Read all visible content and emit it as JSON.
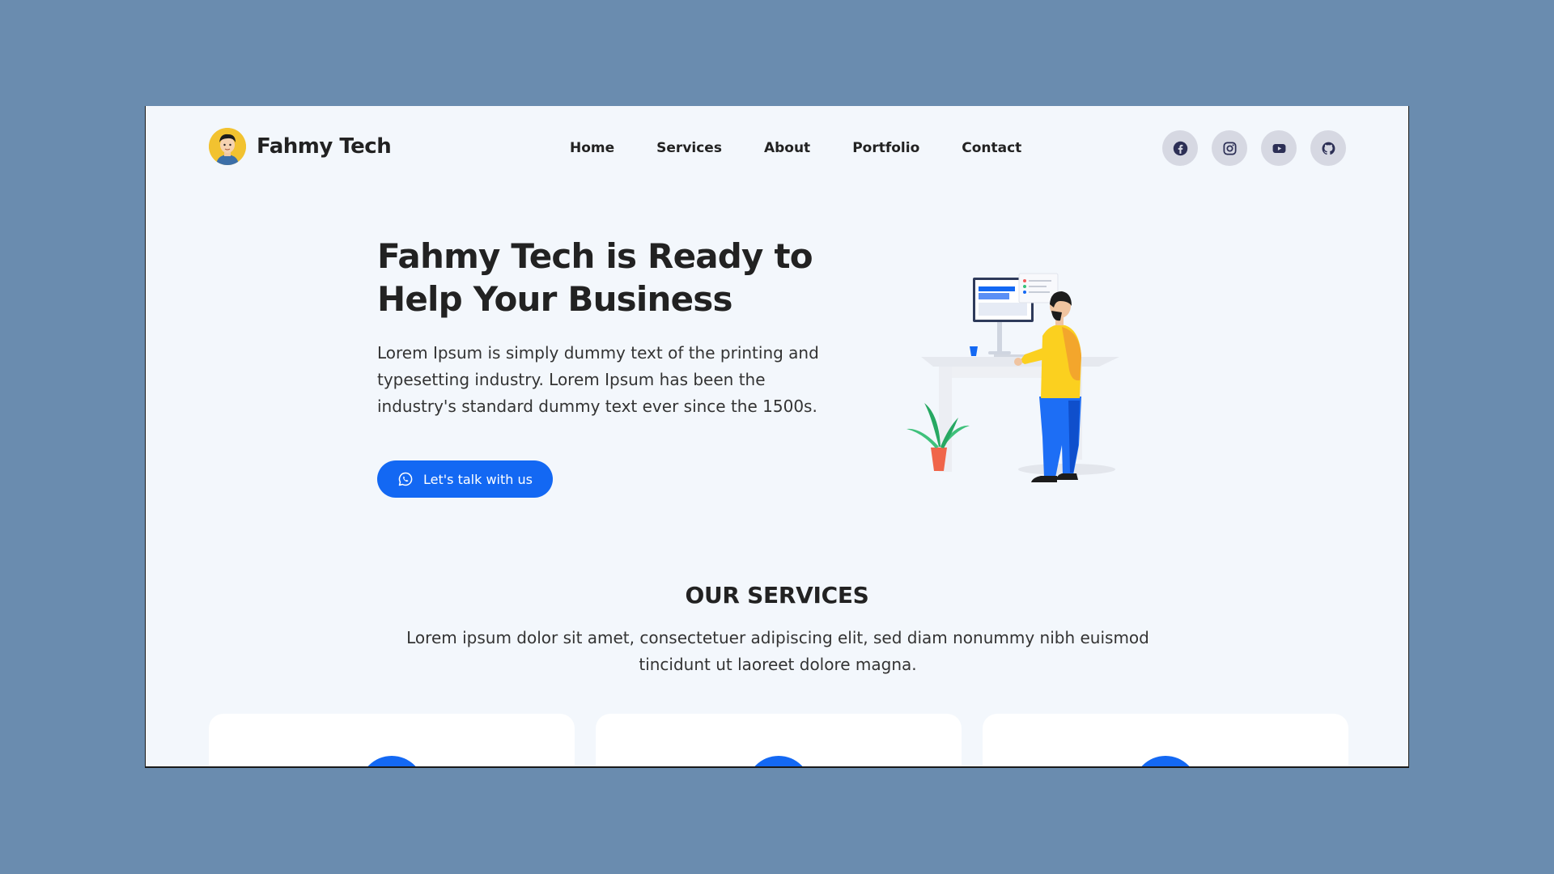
{
  "brand": {
    "name": "Fahmy Tech"
  },
  "nav": [
    {
      "label": "Home"
    },
    {
      "label": "Services"
    },
    {
      "label": "About"
    },
    {
      "label": "Portfolio"
    },
    {
      "label": "Contact"
    }
  ],
  "socials": [
    {
      "icon": "facebook-icon"
    },
    {
      "icon": "instagram-icon"
    },
    {
      "icon": "youtube-icon"
    },
    {
      "icon": "github-icon"
    }
  ],
  "hero": {
    "title": "Fahmy Tech is Ready to Help Your Business",
    "text": "Lorem Ipsum is simply dummy text of the printing and typesetting industry. Lorem Ipsum has been the industry's standard dummy text ever since the 1500s.",
    "cta_label": "Let's talk with us",
    "cta_icon": "whatsapp-icon"
  },
  "services": {
    "title": "OUR SERVICES",
    "text": "Lorem ipsum dolor sit amet, consectetuer adipiscing elit, sed diam nonummy nibh euismod tincidunt ut laoreet dolore magna."
  },
  "colors": {
    "page_bg": "#6a8caf",
    "frame_bg": "#f3f7fc",
    "accent": "#1368f3",
    "social_bg": "#d6d8e2",
    "social_icon": "#2c2f55"
  }
}
